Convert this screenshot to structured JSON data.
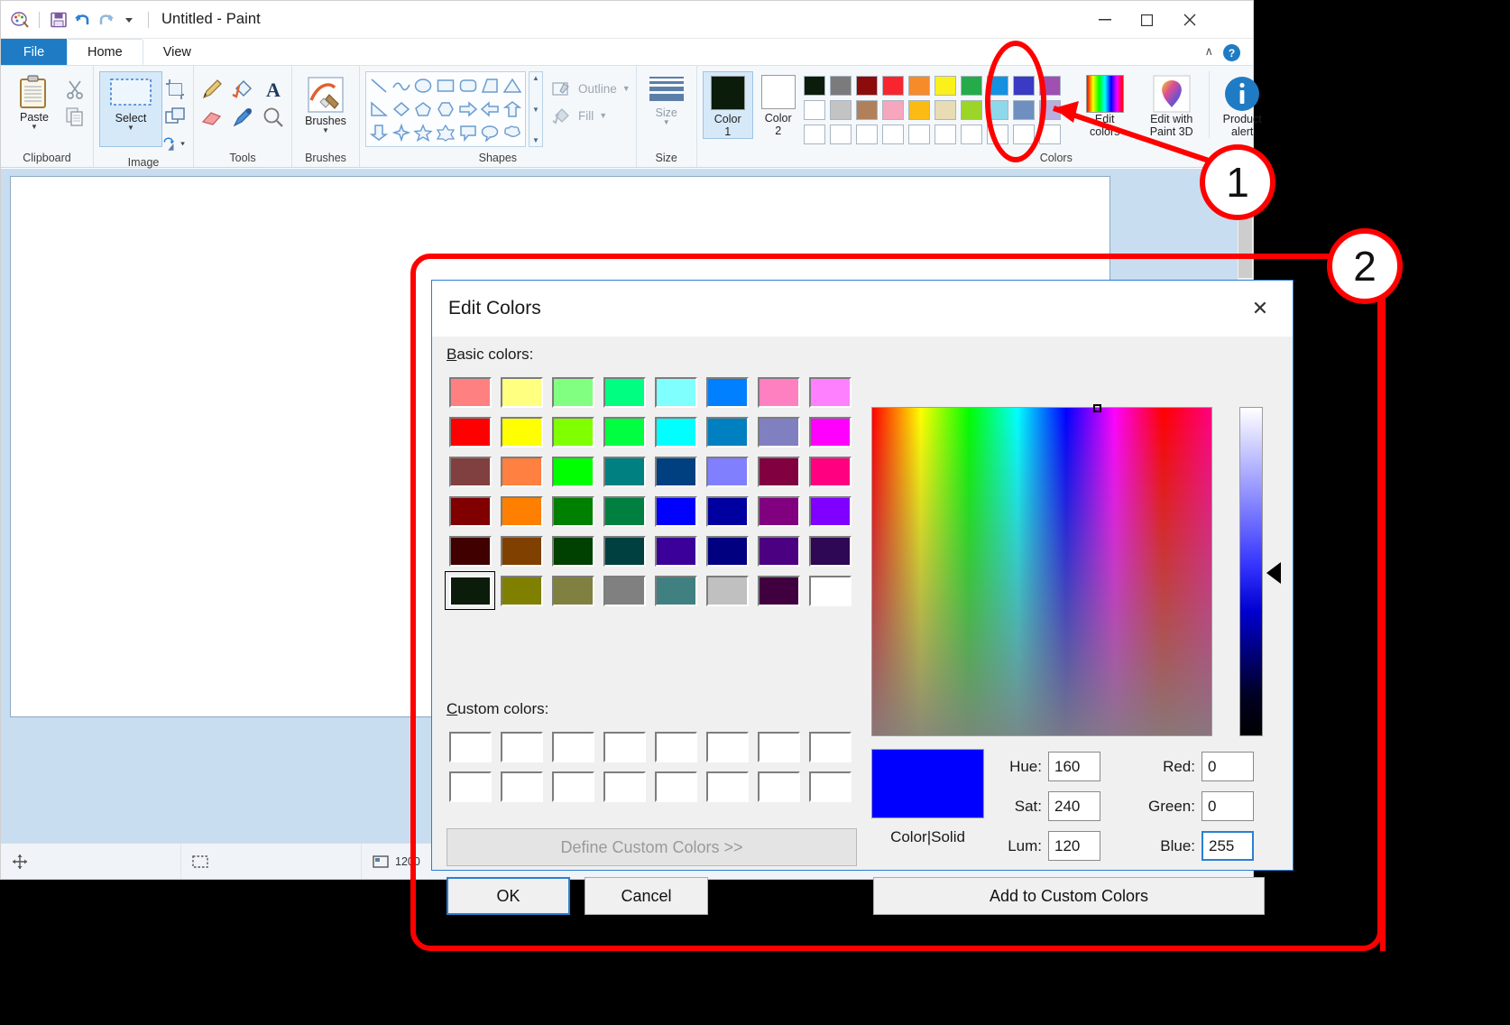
{
  "app": {
    "title": "Untitled - Paint",
    "quick_access": [
      "app-icon",
      "save-icon",
      "undo-icon",
      "redo-icon",
      "customize-caret"
    ],
    "window_buttons": {
      "minimize": "—",
      "maximize": "☐",
      "close": "✕"
    }
  },
  "tabs": [
    {
      "id": "file",
      "label": "File"
    },
    {
      "id": "home",
      "label": "Home"
    },
    {
      "id": "view",
      "label": "View"
    }
  ],
  "ribbon": {
    "collapse_caret": "∧",
    "help": "?",
    "groups": [
      {
        "name": "Clipboard",
        "label": "Clipboard",
        "main": "Paste",
        "items": [
          "Cut",
          "Copy"
        ]
      },
      {
        "name": "Image",
        "label": "Image",
        "main": "Select",
        "items": [
          "Crop",
          "Resize",
          "Rotate"
        ]
      },
      {
        "name": "Tools",
        "label": "Tools",
        "items": [
          "Pencil",
          "Fill with color",
          "Text",
          "Eraser",
          "Color picker",
          "Magnifier"
        ]
      },
      {
        "name": "Brushes",
        "label": "Brushes",
        "main": "Brushes"
      },
      {
        "name": "Shapes",
        "label": "Shapes",
        "outline_label": "Outline",
        "fill_label": "Fill"
      },
      {
        "name": "Size",
        "label": "Size",
        "main": "Size"
      },
      {
        "name": "Colors",
        "label": "Colors",
        "color1_label": "Color",
        "color1_sub": "1",
        "color2_label": "Color",
        "color2_sub": "2",
        "color1_value": "#0b1c0b",
        "color2_value": "#ffffff",
        "edit_colors_label_line1": "Edit",
        "edit_colors_label_line2": "colors",
        "palette_row1": [
          "#0b1c0b",
          "#7b7b7b",
          "#8c0b0b",
          "#f8252e",
          "#f68b2a",
          "#fbf01c",
          "#26ab4b",
          "#1690e0",
          "#3a3ac4",
          "#a050b0"
        ],
        "palette_row2": [
          "#ffffff",
          "#c3c3c3",
          "#b0805a",
          "#f6a6bd",
          "#fbbb14",
          "#e8dcb4",
          "#9bd528",
          "#8ed8ea",
          "#6f8fc0",
          "#b9aee0"
        ],
        "palette_row3": [
          "#ffffff",
          "#ffffff",
          "#ffffff",
          "#ffffff",
          "#ffffff",
          "#ffffff",
          "#ffffff",
          "#ffffff",
          "#ffffff",
          "#ffffff"
        ]
      },
      {
        "name": "Paint3D",
        "label_line1": "Edit with",
        "label_line2": "Paint 3D"
      },
      {
        "name": "ProductAlert",
        "label_line1": "Product",
        "label_line2": "alert"
      }
    ]
  },
  "statusbar": {
    "cells": [
      {
        "icon": "cursor-position-icon",
        "text": ""
      },
      {
        "icon": "selection-size-icon",
        "text": ""
      },
      {
        "icon": "image-size-icon",
        "text": "1200"
      }
    ]
  },
  "dialog": {
    "title": "Edit Colors",
    "close_glyph": "✕",
    "basic_colors_label": "Basic colors:",
    "custom_colors_label": "Custom colors:",
    "color_solid_label": "Color|Solid",
    "basic_colors": [
      [
        "#ff8080",
        "#ffff80",
        "#80ff80",
        "#00ff80",
        "#80ffff",
        "#0080ff",
        "#ff80c0",
        "#ff80ff"
      ],
      [
        "#ff0000",
        "#ffff00",
        "#80ff00",
        "#00ff40",
        "#00ffff",
        "#0080c0",
        "#8080c0",
        "#ff00ff"
      ],
      [
        "#804040",
        "#ff8040",
        "#00ff00",
        "#008080",
        "#004080",
        "#8080ff",
        "#800040",
        "#ff0080"
      ],
      [
        "#800000",
        "#ff8000",
        "#008000",
        "#008040",
        "#0000ff",
        "#0000a0",
        "#800080",
        "#8000ff"
      ],
      [
        "#400000",
        "#804000",
        "#004000",
        "#004040",
        "#3b0099",
        "#000080",
        "#4b0082",
        "#2e0854"
      ],
      [
        "#0b1c0b",
        "#808000",
        "#808040",
        "#808080",
        "#408080",
        "#c0c0c0",
        "#400040",
        "#ffffff"
      ]
    ],
    "selected_basic": {
      "row": 5,
      "col": 0
    },
    "custom_colors": [
      [
        "#ffffff",
        "#ffffff",
        "#ffffff",
        "#ffffff",
        "#ffffff",
        "#ffffff",
        "#ffffff",
        "#ffffff"
      ],
      [
        "#ffffff",
        "#ffffff",
        "#ffffff",
        "#ffffff",
        "#ffffff",
        "#ffffff",
        "#ffffff",
        "#ffffff"
      ]
    ],
    "preview_color": "#0000ff",
    "fields": {
      "hue": {
        "label": "Hue:",
        "value": "160"
      },
      "sat": {
        "label": "Sat:",
        "value": "240"
      },
      "lum": {
        "label": "Lum:",
        "value": "120"
      },
      "red": {
        "label": "Red:",
        "value": "0"
      },
      "green": {
        "label": "Green:",
        "value": "0"
      },
      "blue": {
        "label": "Blue:",
        "value": "255"
      }
    },
    "focused_field": "blue",
    "buttons": {
      "define": "Define Custom Colors >>",
      "ok": "OK",
      "cancel": "Cancel",
      "add_custom": "Add to Custom Colors"
    }
  },
  "annotations": {
    "accent_color": "#ff0000",
    "markers": [
      {
        "id": "1",
        "label": "1"
      },
      {
        "id": "2",
        "label": "2"
      }
    ]
  }
}
